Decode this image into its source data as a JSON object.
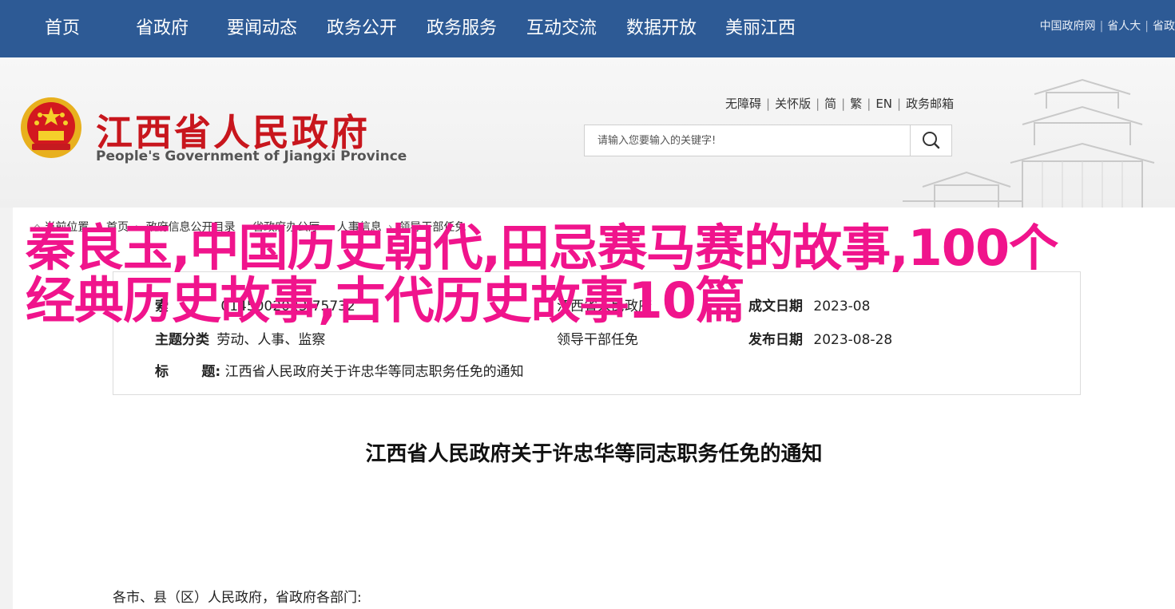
{
  "topnav": {
    "items": [
      {
        "label": "首页"
      },
      {
        "label": "省政府"
      },
      {
        "label": "要闻动态"
      },
      {
        "label": "政务公开"
      },
      {
        "label": "政务服务"
      },
      {
        "label": "互动交流"
      },
      {
        "label": "数据开放"
      },
      {
        "label": "美丽江西"
      }
    ],
    "links": [
      "中国政府网",
      "省人大",
      "省政"
    ]
  },
  "header": {
    "title": "江西省人民政府",
    "subtitle": "People's Government of Jiangxi Province",
    "util_links": [
      "无障碍",
      "关怀版",
      "简",
      "繁",
      "EN",
      "政务邮箱"
    ],
    "search": {
      "placeholder": "请输入您要输入的关键字!"
    }
  },
  "breadcrumb": {
    "items": [
      "当前位置",
      "首页",
      "政府信息公开目录",
      "省政府办公厅",
      "人事信息",
      "领导干部任免"
    ]
  },
  "meta": {
    "index_label": "索",
    "index_value": "014500",
    "index_value2": "2023-75732",
    "issuer_value": "江西省人民政府",
    "date_value": "2023-08",
    "date_label": "成文日期",
    "date_end": "28",
    "topic_label": "主题分类",
    "topic_value": "劳动、人事、监察",
    "topic_value2": "领导干部任免",
    "pub_label": "发布日期",
    "pub_value": "2023-08-28",
    "title_label_a": "标",
    "title_label_b": "题:",
    "title_value": "江西省人民政府关于许忠华等同志职务任免的通知"
  },
  "article": {
    "title": "江西省人民政府关于许忠华等同志职务任免的通知",
    "salutation": "各市、县（区）人民政府，省政府各部门:"
  },
  "overlay": {
    "text": "秦良玉,中国历史朝代,田忌赛马赛的故事,100个经典历史故事,古代历史故事10篇"
  },
  "colors": {
    "nav_bg": "#2d5a95",
    "title_red": "#c8161d",
    "overlay_pink": "#f0148c"
  }
}
